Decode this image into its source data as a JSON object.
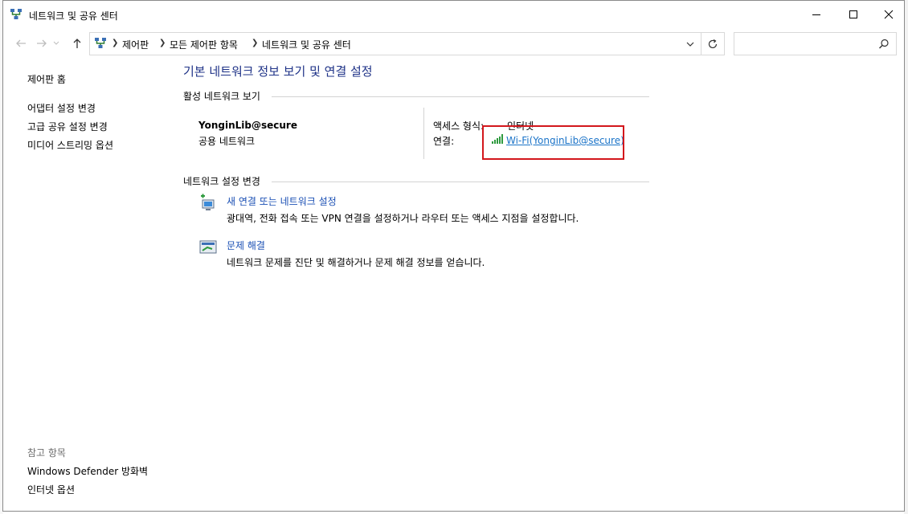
{
  "window": {
    "title": "네트워크 및 공유 센터"
  },
  "address_bar": {
    "crumbs": [
      "제어판",
      "모든 제어판 항목",
      "네트워크 및 공유 센터"
    ],
    "search_placeholder": ""
  },
  "left_pane": {
    "home": "제어판 홈",
    "links": [
      "어댑터 설정 변경",
      "고급 공유 설정 변경",
      "미디어 스트리밍 옵션"
    ],
    "see_also_title": "참고 항목",
    "see_also": [
      "Windows Defender 방화벽",
      "인터넷 옵션"
    ]
  },
  "main": {
    "title": "기본 네트워크 정보 보기 및 연결 설정",
    "active_section": "활성 네트워크 보기",
    "network_name": "YonginLib@secure",
    "network_category": "공용 네트워크",
    "access_type_label": "액세스 형식:",
    "access_type_value": "인터넷",
    "connections_label": "연결:",
    "connection_link": "Wi-Fi(YonginLib@secure)",
    "change_section": "네트워크 설정 변경",
    "tasks": [
      {
        "title": "새 연결 또는 네트워크 설정",
        "desc": "광대역, 전화 접속 또는 VPN 연결을 설정하거나 라우터 또는 액세스 지점을 설정합니다.",
        "icon": "new-connection-icon"
      },
      {
        "title": "문제 해결",
        "desc": "네트워크 문제를 진단 및 해결하거나 문제 해결 정보를 얻습니다.",
        "icon": "troubleshoot-icon"
      }
    ]
  },
  "colors": {
    "heading": "#1e3287",
    "link": "#1a73c8",
    "highlight": "#d3171c"
  }
}
